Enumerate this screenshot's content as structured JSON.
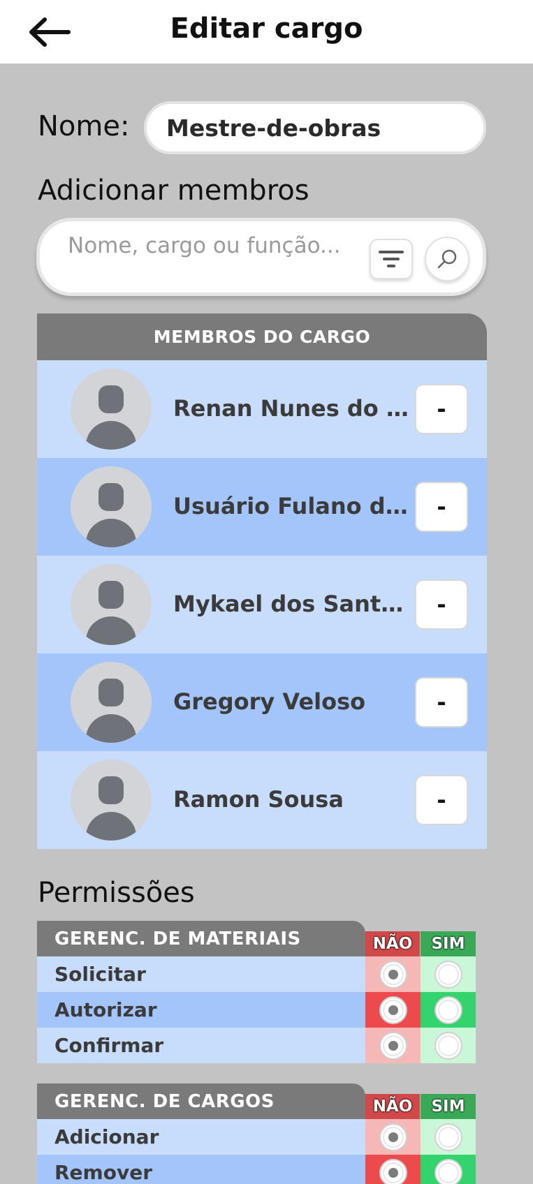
{
  "header": {
    "title": "Editar cargo"
  },
  "form": {
    "name_label": "Nome:",
    "name_value": "Mestre-de-obras",
    "add_members_label": "Adicionar membros",
    "search_placeholder": "Nome, cargo ou função..."
  },
  "members": {
    "header": "MEMBROS DO CARGO",
    "remove_label": "-",
    "items": [
      {
        "name": "Renan Nunes do Santos"
      },
      {
        "name": "Usuário Fulano de Tal"
      },
      {
        "name": "Mykael dos Santos Silva"
      },
      {
        "name": "Gregory Veloso"
      },
      {
        "name": "Ramon Sousa"
      }
    ]
  },
  "permissions": {
    "title": "Permissões",
    "no_label": "NÃO",
    "yes_label": "SIM",
    "groups": [
      {
        "name": "GERENC. DE MATERIAIS",
        "rows": [
          {
            "label": "Solicitar",
            "selected": "nao"
          },
          {
            "label": "Autorizar",
            "selected": "nao"
          },
          {
            "label": "Confirmar",
            "selected": "nao"
          }
        ]
      },
      {
        "name": "GERENC. DE CARGOS",
        "rows": [
          {
            "label": "Adicionar",
            "selected": "nao"
          },
          {
            "label": "Remover",
            "selected": "nao"
          }
        ]
      }
    ]
  },
  "colors": {
    "background": "#c3c3c3",
    "row_light": "#c8dcfb",
    "row_dark": "#a3c5fa",
    "header_gray": "#7a7a7a",
    "no_red": "#ec4a4d",
    "yes_green": "#33d36e"
  }
}
